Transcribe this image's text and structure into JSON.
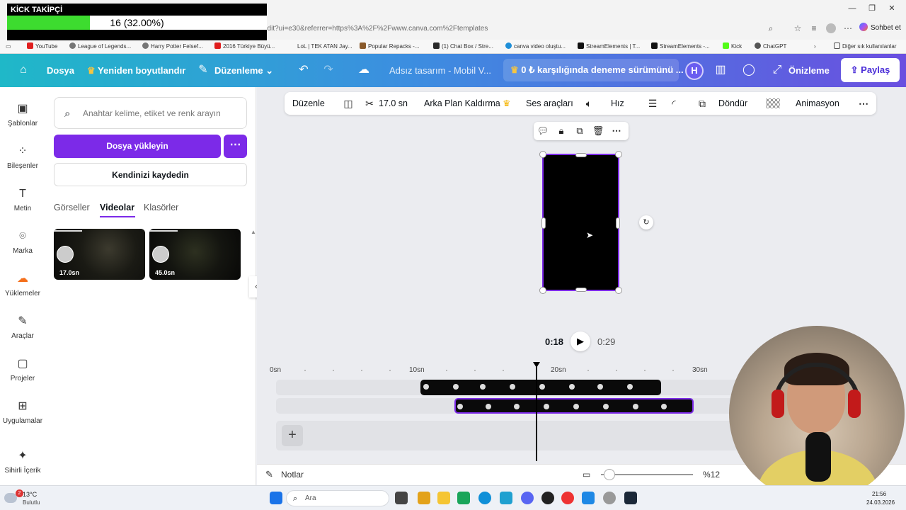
{
  "browser": {
    "url": "edit?ui=e30&referrer=https%3A%2F%2Fwww.canva.com%2Ftemplates",
    "chat_label": "Sohbet et",
    "bookmarks": [
      "YouTube",
      "League of Legends...",
      "Harry Potter Felsef...",
      "2016 Türkiye Büyü...",
      "LoL | TEK ATAN Jay...",
      "Popular Repacks -...",
      "(1) Chat Box / Stre...",
      "canva video oluştu...",
      "StreamElements | T...",
      "StreamElements -...",
      "Kick",
      "ChatGPT"
    ],
    "other_bookmarks": "Diğer sık kullanılanlar"
  },
  "kick_overlay": {
    "title": "KİCK TAKİPÇİ",
    "count": "16 (32.00%)",
    "progress_fraction": 0.32
  },
  "header": {
    "file_label": "Dosya",
    "resize_label": "Yeniden boyutlandır",
    "edit_label": "Düzenleme",
    "doc_title": "Adsız tasarım - Mobil V...",
    "trial_label": "0 ₺ karşılığında deneme sürümünü ...",
    "avatar_initial": "H",
    "preview_label": "Önizleme",
    "share_label": "Paylaş"
  },
  "rail": {
    "items": [
      {
        "label": "Şablonlar",
        "icon": "templates-icon"
      },
      {
        "label": "Bileşenler",
        "icon": "elements-icon"
      },
      {
        "label": "Metin",
        "icon": "text-icon"
      },
      {
        "label": "Marka",
        "icon": "brand-icon"
      },
      {
        "label": "Yüklemeler",
        "icon": "uploads-icon"
      },
      {
        "label": "Araçlar",
        "icon": "tools-icon"
      },
      {
        "label": "Projeler",
        "icon": "projects-icon"
      },
      {
        "label": "Uygulamalar",
        "icon": "apps-icon"
      },
      {
        "label": "Sihirli İçerik",
        "icon": "magic-icon"
      }
    ]
  },
  "panel": {
    "search_placeholder": "Anahtar kelime, etiket ve renk arayın",
    "upload_label": "Dosya yükleyin",
    "record_label": "Kendinizi kaydedin",
    "tabs": [
      "Görseller",
      "Videolar",
      "Klasörler"
    ],
    "videos": [
      {
        "duration": "17.0sn"
      },
      {
        "duration": "45.0sn"
      }
    ]
  },
  "toolbar": {
    "edit_label": "Düzenle",
    "trim_label": "17.0 sn",
    "bg_remove_label": "Arka Plan Kaldırma",
    "audio_label": "Ses araçları",
    "speed_label": "Hız",
    "rotate_label": "Döndür",
    "animation_label": "Animasyon"
  },
  "player": {
    "current_time": "0:18",
    "total_time": "0:29"
  },
  "timeline": {
    "ruler": [
      "0sn",
      "10sn",
      "20sn",
      "30sn"
    ]
  },
  "bottom": {
    "notes_label": "Notlar",
    "zoom_label": "%12"
  },
  "taskbar": {
    "weather_temp": "13°C",
    "weather_desc": "Bulutlu",
    "weather_badge": "2",
    "search_placeholder": "Ara",
    "time": "21:56",
    "date": "24.03.2026"
  }
}
